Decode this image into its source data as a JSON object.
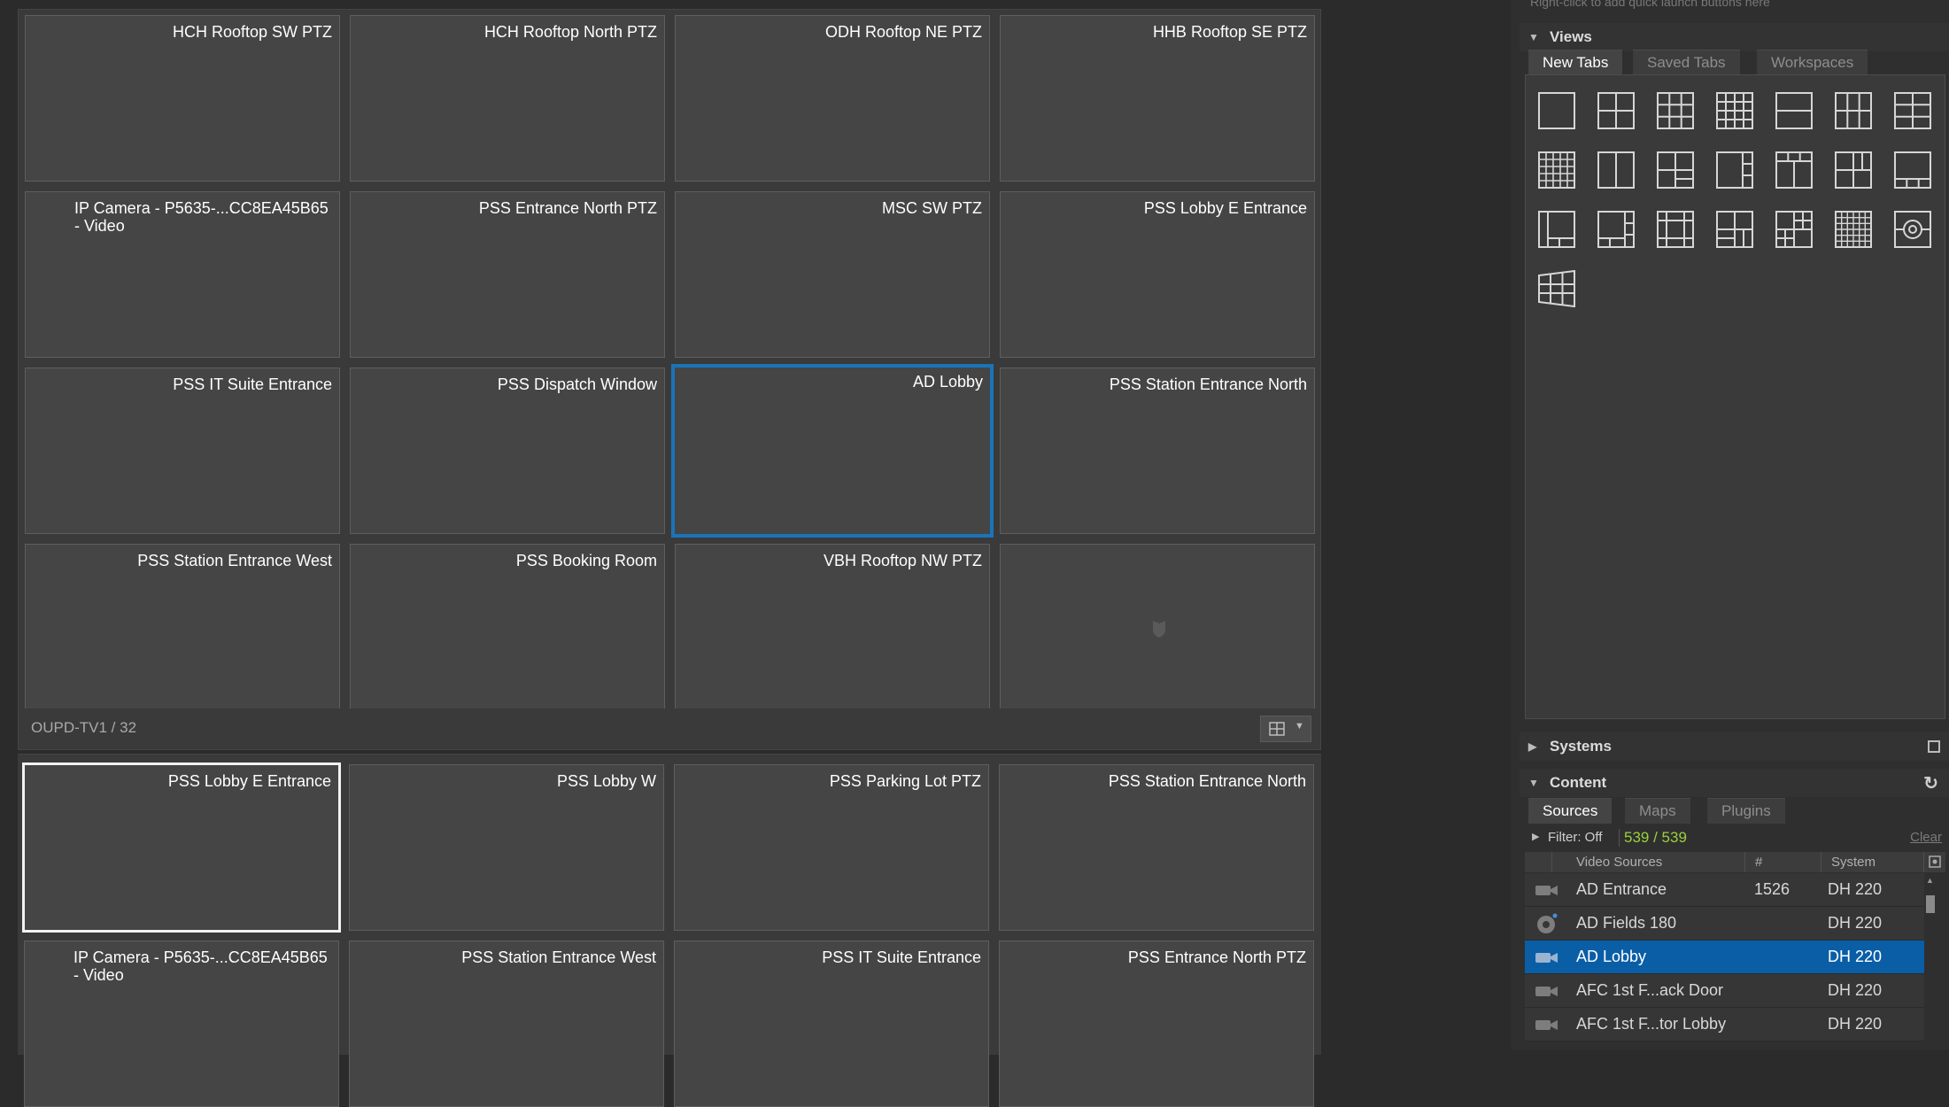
{
  "top_wall": {
    "tiles": [
      {
        "label": "HCH Rooftop SW PTZ"
      },
      {
        "label": "HCH Rooftop North PTZ"
      },
      {
        "label": "ODH Rooftop NE PTZ"
      },
      {
        "label": "HHB Rooftop SE PTZ"
      },
      {
        "label": "IP Camera - P5635-...CC8EA45B65 - Video"
      },
      {
        "label": "PSS Entrance North PTZ"
      },
      {
        "label": "MSC SW PTZ"
      },
      {
        "label": "PSS Lobby E Entrance"
      },
      {
        "label": "PSS IT Suite Entrance"
      },
      {
        "label": "PSS Dispatch Window"
      },
      {
        "label": "AD Lobby"
      },
      {
        "label": "PSS Station Entrance North"
      },
      {
        "label": "PSS Station Entrance West"
      },
      {
        "label": "PSS Booking Room"
      },
      {
        "label": "VBH Rooftop NW PTZ"
      },
      {
        "label": ""
      }
    ],
    "footer_label": "OUPD-TV1 / 32"
  },
  "bottom_wall": {
    "tiles": [
      {
        "label": "PSS Lobby E Entrance"
      },
      {
        "label": "PSS Lobby W"
      },
      {
        "label": "PSS Parking Lot PTZ"
      },
      {
        "label": "PSS Station Entrance North"
      },
      {
        "label": "IP Camera - P5635-...CC8EA45B65 - Video"
      },
      {
        "label": "PSS Station Entrance West"
      },
      {
        "label": "PSS IT Suite Entrance"
      },
      {
        "label": "PSS Entrance North PTZ"
      }
    ]
  },
  "right_panel": {
    "quick_launch_hint": "Right-click to add quick launch buttons here",
    "views": {
      "title": "Views",
      "tabs": [
        "New Tabs",
        "Saved Tabs",
        "Workspaces"
      ]
    },
    "systems": {
      "title": "Systems"
    },
    "content": {
      "title": "Content",
      "tabs": [
        "Sources",
        "Maps",
        "Plugins"
      ],
      "filter_label": "Filter: Off",
      "filter_count": "539 / 539",
      "clear_label": "Clear",
      "columns": [
        "Video Sources",
        "#",
        "System"
      ],
      "rows": [
        {
          "name": "AD Entrance",
          "number": "1526",
          "system": "DH 220",
          "icon": "camera-icon"
        },
        {
          "name": "AD Fields 180",
          "number": "",
          "system": "DH 220",
          "icon": "dome-camera-icon"
        },
        {
          "name": "AD Lobby",
          "number": "",
          "system": "DH 220",
          "icon": "camera-icon"
        },
        {
          "name": "AFC 1st F...ack Door",
          "number": "",
          "system": "DH 220",
          "icon": "camera-icon"
        },
        {
          "name": "AFC 1st F...tor Lobby",
          "number": "",
          "system": "DH 220",
          "icon": "camera-icon"
        }
      ]
    }
  },
  "colors": {
    "selection_blue": "#1a74b8",
    "row_selected": "#0a5ea6",
    "filter_green": "#9bd13a"
  }
}
